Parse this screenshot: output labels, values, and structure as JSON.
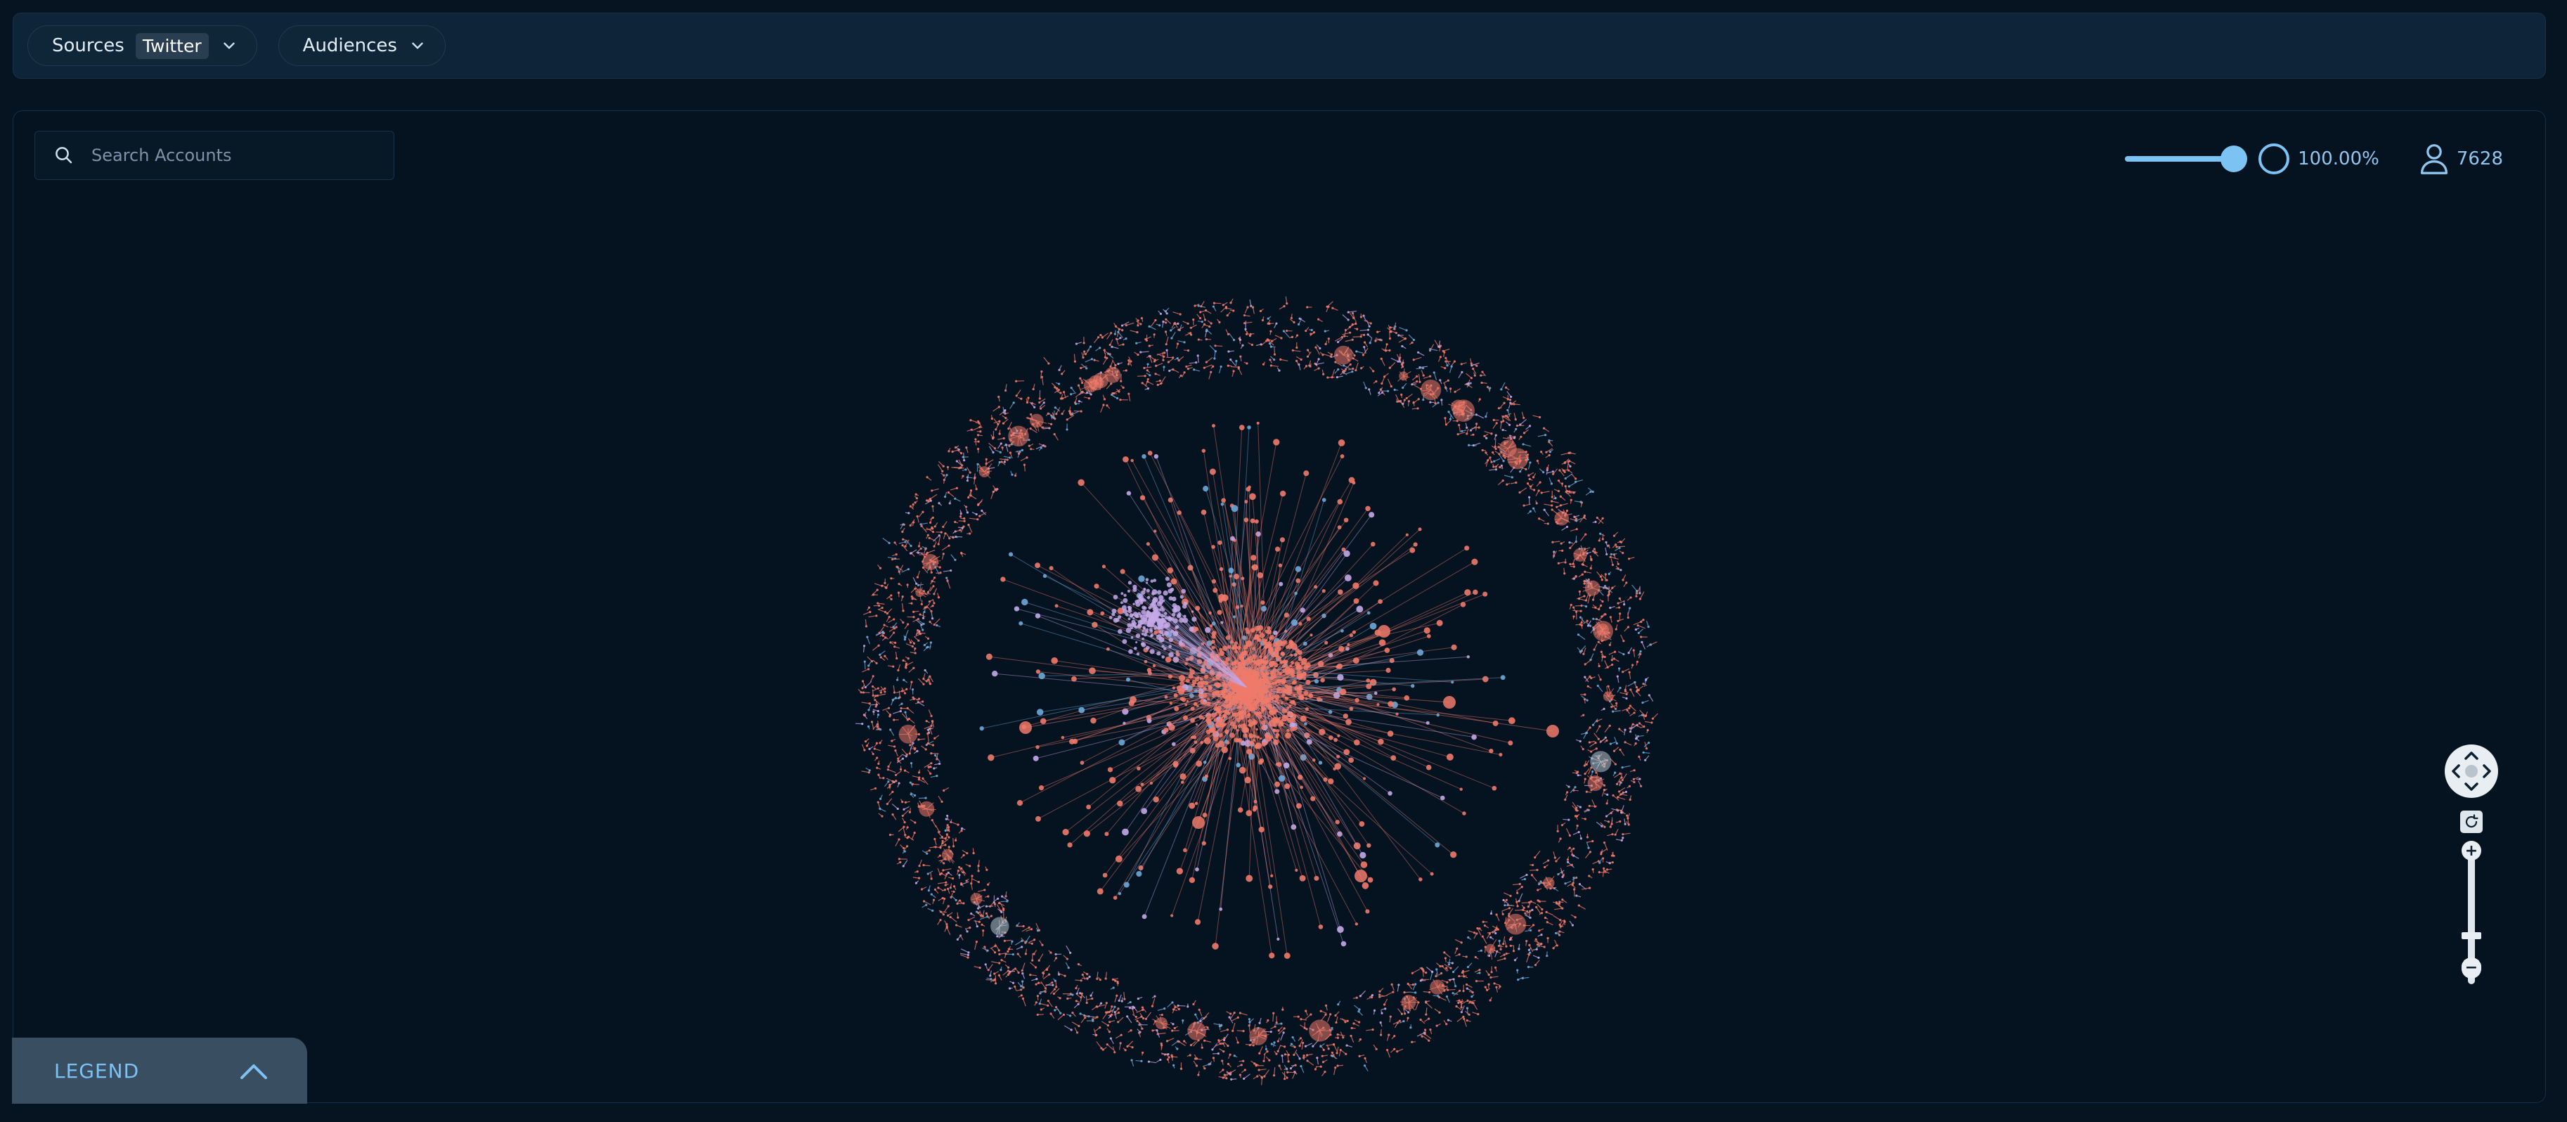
{
  "filters": {
    "sources_label": "Sources",
    "sources_value": "Twitter",
    "audiences_label": "Audiences"
  },
  "search": {
    "placeholder": "Search Accounts"
  },
  "controls": {
    "threshold_percent": 100,
    "threshold_text": "100.00%",
    "account_count": "7628"
  },
  "legend": {
    "label": "LEGEND"
  },
  "zoom": {
    "plus": "+",
    "minus": "−"
  },
  "colors": {
    "accent": "#7cc2f2",
    "node_primary": "#f07a6a",
    "node_secondary": "#c4a8e8",
    "node_tertiary": "#6ea9d8",
    "background": "#051321"
  },
  "icons": {
    "search": "search-icon",
    "dropdown": "chevron-down-icon",
    "user": "user-icon",
    "legend_toggle": "chevron-up-icon",
    "pan": "pan-arrows-icon",
    "reset": "reset-view-icon"
  }
}
